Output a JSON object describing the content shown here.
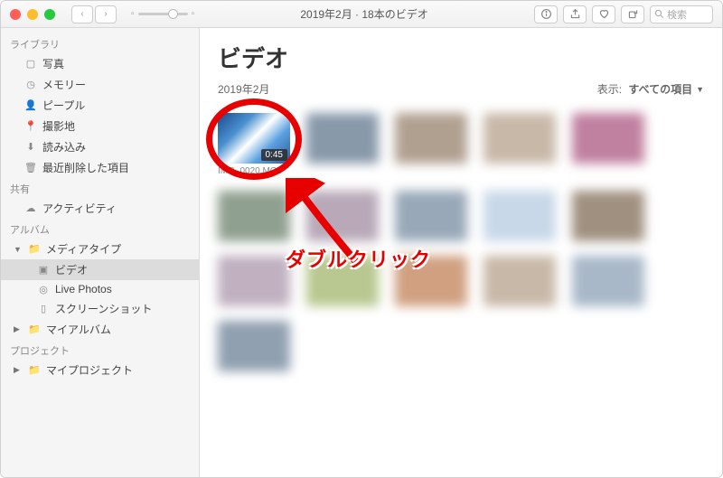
{
  "titlebar": {
    "title": "2019年2月 · 18本のビデオ",
    "search_placeholder": "検索"
  },
  "sidebar": {
    "groups": {
      "library": "ライブラリ",
      "share": "共有",
      "albums": "アルバム",
      "projects": "プロジェクト"
    },
    "items": {
      "photos": "写真",
      "memories": "メモリー",
      "people": "ピープル",
      "places": "撮影地",
      "imports": "読み込み",
      "recently_deleted": "最近削除した項目",
      "activity": "アクティビティ",
      "media_types": "メディアタイプ",
      "videos": "ビデオ",
      "live_photos": "Live Photos",
      "screenshots": "スクリーンショット",
      "my_albums": "マイアルバム",
      "my_projects": "マイプロジェクト"
    }
  },
  "main": {
    "heading": "ビデオ",
    "subheading": "2019年2月",
    "view_label": "表示:",
    "view_value": "すべての項目"
  },
  "first_item": {
    "duration": "0:45",
    "filename": "IMG_0020.MOV"
  },
  "annotation": "ダブルクリック",
  "blur_colors": [
    "#aabbcc",
    "#8899aa",
    "#b0a090",
    "#c8b8a8",
    "#c080a0",
    "#90a090",
    "#b8a8b8",
    "#98a8b8",
    "#c8d8e8",
    "#a09080",
    "#c0b0c0",
    "#b8c890",
    "#d0a080",
    "#c8b8a8",
    "#a8b8c8",
    "#90a0b0",
    "#d0c0b0",
    "#b0c0a0",
    "#c0a0b0",
    "#a8b8a8"
  ]
}
